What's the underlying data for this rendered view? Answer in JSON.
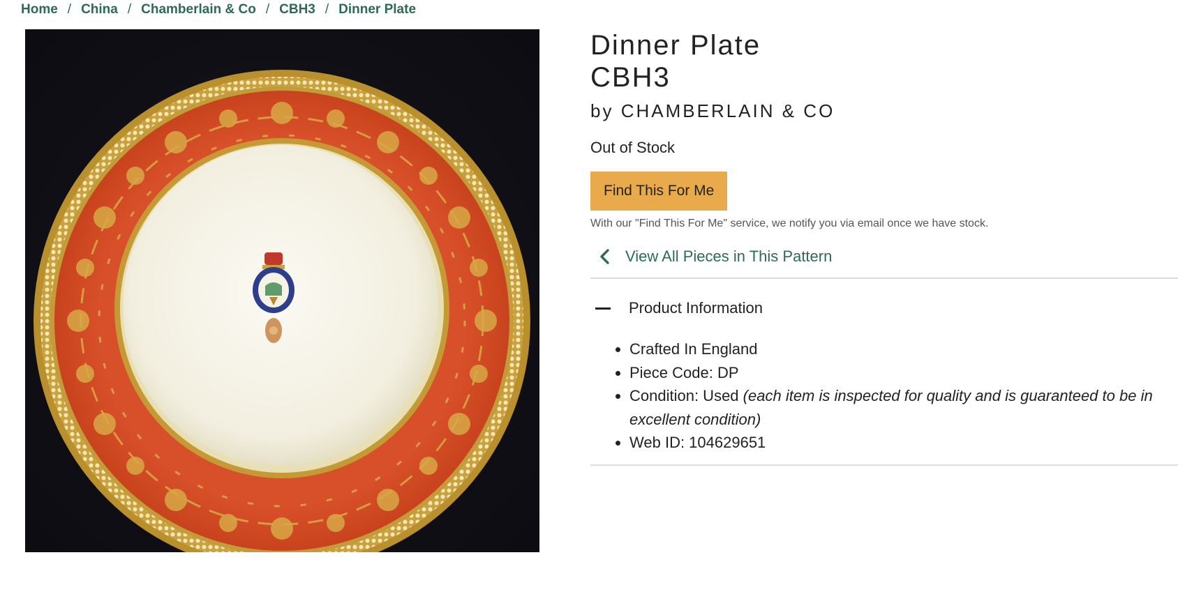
{
  "breadcrumb": {
    "items": [
      "Home",
      "China",
      "Chamberlain & Co",
      "CBH3",
      "Dinner Plate"
    ],
    "separator": "/"
  },
  "product": {
    "image_alt": "Dinner Plate",
    "title_line1": "Dinner Plate",
    "title_line2": "CBH3",
    "by_prefix": "by",
    "brand": "CHAMBERLAIN & CO",
    "stock_status": "Out of Stock",
    "find_button": "Find This For Me",
    "find_note": "With our \"Find This For Me\" service, we notify you via email once we have stock.",
    "view_all_link": "View All Pieces in This Pattern"
  },
  "product_info": {
    "heading": "Product Information",
    "crafted": "Crafted In England",
    "piece_code_label": "Piece Code: DP",
    "condition_label": "Condition: Used",
    "condition_note": "(each item is inspected for quality and is guaranteed to be in excellent condition)",
    "web_id_label": "Web ID: 104629651"
  },
  "colors": {
    "link_green": "#2d6a55",
    "button_orange": "#e8aa4a",
    "plate_rim_red": "#d64a22",
    "gold": "#c9a23e"
  },
  "icons": {
    "view_all": "chevron-left-icon",
    "accordion": "minus-icon"
  }
}
